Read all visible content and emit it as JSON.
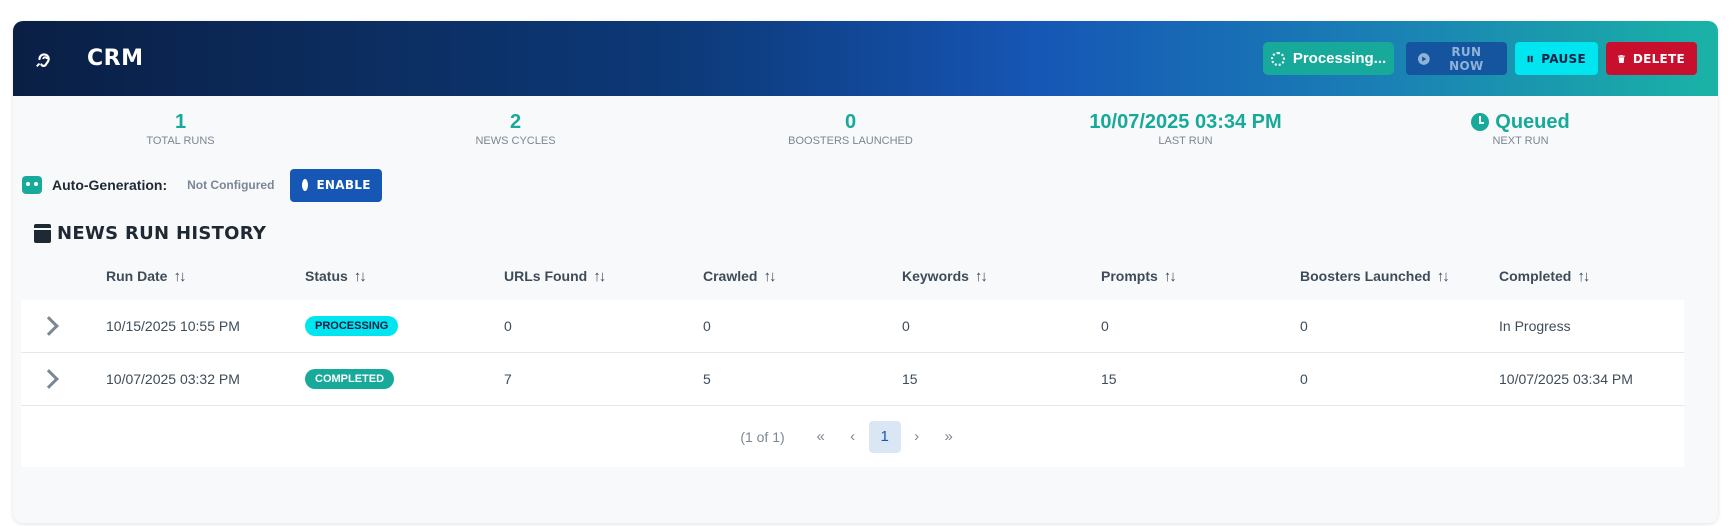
{
  "header": {
    "title": "CRM",
    "processing_label": "Processing...",
    "run_now_label": "RUN NOW",
    "pause_label": "PAUSE",
    "delete_label": "DELETE"
  },
  "stats": [
    {
      "value": "1",
      "label": "TOTAL RUNS"
    },
    {
      "value": "2",
      "label": "NEWS CYCLES"
    },
    {
      "value": "0",
      "label": "BOOSTERS LAUNCHED"
    },
    {
      "value": "10/07/2025 03:34 PM",
      "label": "LAST RUN"
    },
    {
      "value": "Queued",
      "label": "NEXT RUN"
    }
  ],
  "autogen": {
    "label": "Auto-Generation:",
    "status": "Not Configured",
    "enable_label": "ENABLE"
  },
  "history": {
    "title": "NEWS RUN HISTORY",
    "columns": [
      "Run Date",
      "Status",
      "URLs Found",
      "Crawled",
      "Keywords",
      "Prompts",
      "Boosters Launched",
      "Completed"
    ],
    "rows": [
      {
        "run_date": "10/15/2025 10:55 PM",
        "status": "PROCESSING",
        "urls": "0",
        "crawled": "0",
        "keywords": "0",
        "prompts": "0",
        "boosters": "0",
        "completed": "In Progress"
      },
      {
        "run_date": "10/07/2025 03:32 PM",
        "status": "COMPLETED",
        "urls": "7",
        "crawled": "5",
        "keywords": "15",
        "prompts": "15",
        "boosters": "0",
        "completed": "10/07/2025 03:34 PM"
      }
    ]
  },
  "pagination": {
    "info": "(1 of 1)",
    "current_page": "1",
    "first": "«",
    "prev": "‹",
    "next": "›",
    "last": "»"
  },
  "colors": {
    "accent": "#17a99a",
    "primary": "#1656b5",
    "danger": "#c8102e",
    "cyan": "#00e5ef"
  },
  "icons": [
    "ear-icon",
    "spinner-icon",
    "play-circle-icon",
    "pause-icon",
    "trash-icon",
    "clock-icon",
    "robot-icon",
    "gear-icon",
    "calendar-icon",
    "sort-icon",
    "chevron-right-icon"
  ]
}
